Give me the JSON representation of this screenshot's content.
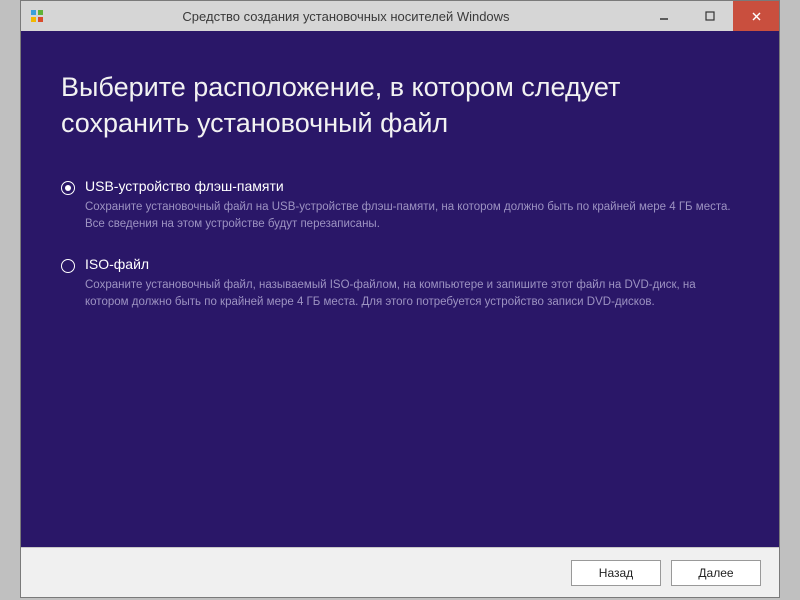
{
  "titlebar": {
    "title": "Средство создания установочных носителей Windows"
  },
  "main": {
    "heading": "Выберите расположение, в котором следует сохранить установочный файл",
    "options": [
      {
        "label": "USB-устройство флэш-памяти",
        "description": "Сохраните установочный файл на USB-устройстве флэш-памяти, на котором должно быть по крайней мере 4 ГБ места. Все сведения на этом устройстве будут перезаписаны.",
        "selected": true
      },
      {
        "label": "ISO-файл",
        "description": "Сохраните установочный файл, называемый ISO-файлом, на компьютере и запишите этот файл на DVD-диск, на котором должно быть по крайней мере 4 ГБ места. Для этого потребуется устройство записи DVD-дисков.",
        "selected": false
      }
    ]
  },
  "footer": {
    "back_label": "Назад",
    "next_label": "Далее"
  }
}
